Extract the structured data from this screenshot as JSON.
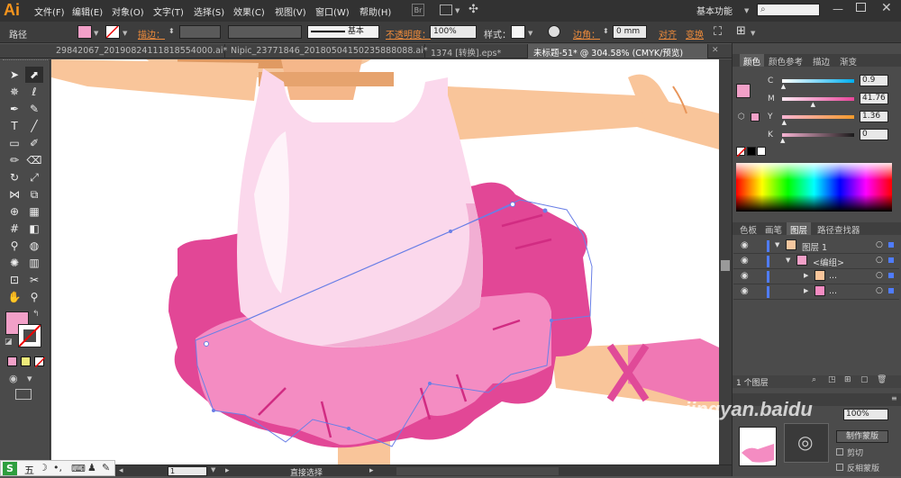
{
  "app": {
    "logo": "Ai"
  },
  "menu": [
    "文件(F)",
    "编辑(E)",
    "对象(O)",
    "文字(T)",
    "选择(S)",
    "效果(C)",
    "视图(V)",
    "窗口(W)",
    "帮助(H)"
  ],
  "workspace": {
    "label": "基本功能"
  },
  "control_bar": {
    "object_type": "路径",
    "stroke_label": "描边：",
    "stroke_style": "基本",
    "opacity_label": "不透明度：",
    "opacity_value": "100%",
    "style_label": "样式：",
    "corner_label": "边角：",
    "corner_value": "0 mm",
    "align_label": "对齐",
    "transform_label": "变换"
  },
  "colors": {
    "fill": "#f2a0c8",
    "accent": "#f08c3b"
  },
  "tabs": [
    {
      "label": "29842067_20190824111818554000.ai*",
      "active": false
    },
    {
      "label": "Nipic_23771846_20180504150235888088.ai*",
      "active": false
    },
    {
      "label": "1374 [转换].eps*",
      "active": false
    },
    {
      "label": "未标题-51* @ 304.58% (CMYK/预览)",
      "active": true
    }
  ],
  "color_panel": {
    "tabs": [
      "颜色",
      "颜色参考",
      "描边",
      "渐变"
    ],
    "channels": [
      {
        "name": "C",
        "value": "0.9",
        "fraction": 0.01,
        "color": "#f1a7cd"
      },
      {
        "name": "M",
        "value": "41.76",
        "fraction": 0.42,
        "color": "#e8459a"
      },
      {
        "name": "Y",
        "value": "1.36",
        "fraction": 0.02,
        "color": "#f7b4d3"
      },
      {
        "name": "K",
        "value": "0",
        "fraction": 0.0,
        "color": "#1a1a1a"
      }
    ]
  },
  "layers_panel": {
    "tabs": [
      "色板",
      "画笔",
      "图层",
      "路径查找器"
    ],
    "rows": [
      {
        "label": "图层 1",
        "indent": 0
      },
      {
        "label": "<编组>",
        "indent": 1
      },
      {
        "label": "...",
        "indent": 2
      },
      {
        "label": "...",
        "indent": 2
      }
    ],
    "count": "1 个图层"
  },
  "transparency_panel": {
    "opacity_value": "100%",
    "make_mask_label": "制作蒙版",
    "clip_label": "剪切",
    "invert_label": "反相蒙版"
  },
  "status": {
    "tool": "直接选择",
    "page": "1"
  },
  "taskbar": {
    "ime_label": "五"
  },
  "watermark": "jingyan.baidu"
}
